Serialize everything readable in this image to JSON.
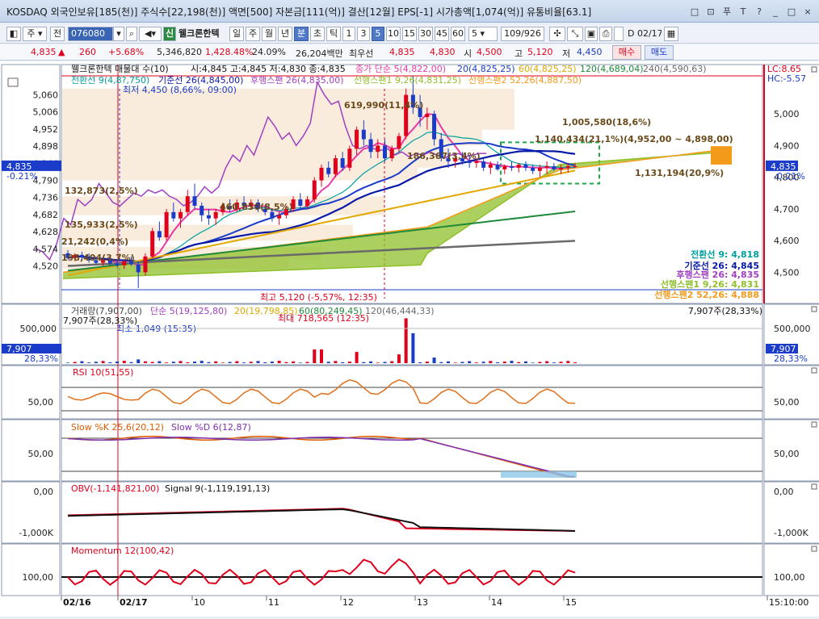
{
  "window": {
    "title": "KOSDAQ 외국인보유[185(천)] 주식수[22,198(천)] 액면[500] 자본금[111(억)] 결산[12월] EPS[-1] 시가총액[1,074(억)] 유통비율[63.1]",
    "controls": [
      "□",
      "⊡",
      "푸",
      "T",
      "?",
      "_",
      "□",
      "×"
    ]
  },
  "toolbar": {
    "type_label": "주",
    "prev_label": "전",
    "code_value": "076080",
    "stock_name": "웰크론한텍",
    "signal_label": "신",
    "periods": [
      "일",
      "주",
      "월",
      "년",
      "분",
      "초",
      "틱"
    ],
    "active_period": "분",
    "intervals": [
      "1",
      "3",
      "5",
      "10",
      "15",
      "30",
      "45",
      "60"
    ],
    "active_interval": "5",
    "count_value": "5",
    "page_value": "109/926",
    "date_value": "02/17"
  },
  "quote": {
    "price": "4,835",
    "arrow": "▲",
    "change": "260",
    "change_pct": "+5.68%",
    "volume": "5,346,820",
    "vol_ratio": "1,428.48%",
    "turnover": "24.09%",
    "amount": "26,204백만",
    "best_label": "최우선",
    "best_ask": "4,835",
    "best_bid": "4,830",
    "open_label": "시",
    "open": "4,500",
    "high_label": "고",
    "high": "5,120",
    "low_label": "저",
    "low": "4,450",
    "buy_label": "매수",
    "sell_label": "매도"
  },
  "colors": {
    "up": "#e0001b",
    "down": "#1a3cc8",
    "conversion": "#00a0a0",
    "base": "#0a1aa8",
    "lagging": "#a040c0",
    "leadingA": "#8fc02a",
    "leadingB": "#f49a1a",
    "ma5": "#e83aa8",
    "ma20": "#1a3cc8",
    "ma60": "#e0a800",
    "ma120": "#1e8a3a",
    "ma240": "#6a6a6a"
  },
  "chart_data": [
    {
      "type": "candlestick",
      "panel": "price",
      "title": "웰크론한텍 매물대 수(10)",
      "ohlc_label": "시:4,845 고:4,845 저:4,830 종:4,835",
      "ma_legend": [
        {
          "label": "종가 단순 5(4,822,00)",
          "color": "#e83aa8"
        },
        {
          "label": "20(4,825,25)",
          "color": "#1a3cc8"
        },
        {
          "label": "60(4,825,25)",
          "color": "#e0a800"
        },
        {
          "label": "120(4,689,04)",
          "color": "#1e8a3a"
        },
        {
          "label": "240(4,590,63)",
          "color": "#6a6a6a"
        }
      ],
      "ichimoku_legend": [
        {
          "label": "전환선 9(4,8?,750)",
          "color": "#00a0a0"
        },
        {
          "label": "기준선 26(4,845,00)",
          "color": "#0a1aa8"
        },
        {
          "label": "후행스팬 26(4,835,00)",
          "color": "#a040c0"
        },
        {
          "label": "선행스팬1 9,26(4,831,25)",
          "color": "#8fc02a"
        },
        {
          "label": "선행스팬2 52,26(4,887,50)",
          "color": "#f49a1a"
        }
      ],
      "ylim": [
        4450,
        5120
      ],
      "y_ticks": [
        "5,060",
        "5,006",
        "4,952",
        "4,898",
        "4,844",
        "4,790",
        "4,736",
        "4,682",
        "4,628",
        "4,574",
        "4,520"
      ],
      "right_ticks": [
        "5,000",
        "4,900",
        "4,800",
        "4,700",
        "4,600",
        "4,500"
      ],
      "current_label": "4,835",
      "current_pct": "-0.21%",
      "lc_label": "LC:8.65",
      "hc_label": "HC:-5.57",
      "x_ticks": [
        "02/16",
        "02/17",
        "10",
        "11",
        "12",
        "13",
        "14",
        "15",
        "15:10:00"
      ],
      "candles": [
        {
          "o": 4560,
          "h": 4570,
          "l": 4540,
          "c": 4545
        },
        {
          "o": 4545,
          "h": 4560,
          "l": 4535,
          "c": 4555
        },
        {
          "o": 4555,
          "h": 4565,
          "l": 4540,
          "c": 4548
        },
        {
          "o": 4548,
          "h": 4560,
          "l": 4530,
          "c": 4538
        },
        {
          "o": 4538,
          "h": 4550,
          "l": 4525,
          "c": 4530
        },
        {
          "o": 4530,
          "h": 4545,
          "l": 4520,
          "c": 4540
        },
        {
          "o": 4540,
          "h": 4555,
          "l": 4520,
          "c": 4528
        },
        {
          "o": 4528,
          "h": 4540,
          "l": 4515,
          "c": 4522
        },
        {
          "o": 4522,
          "h": 4540,
          "l": 4510,
          "c": 4535
        },
        {
          "o": 4535,
          "h": 4550,
          "l": 4520,
          "c": 4525
        },
        {
          "o": 4525,
          "h": 4535,
          "l": 4450,
          "c": 4500
        },
        {
          "o": 4500,
          "h": 4560,
          "l": 4490,
          "c": 4550
        },
        {
          "o": 4550,
          "h": 4640,
          "l": 4545,
          "c": 4630
        },
        {
          "o": 4630,
          "h": 4660,
          "l": 4600,
          "c": 4610
        },
        {
          "o": 4610,
          "h": 4700,
          "l": 4600,
          "c": 4690
        },
        {
          "o": 4690,
          "h": 4720,
          "l": 4660,
          "c": 4670
        },
        {
          "o": 4670,
          "h": 4700,
          "l": 4640,
          "c": 4690
        },
        {
          "o": 4690,
          "h": 4760,
          "l": 4680,
          "c": 4740
        },
        {
          "o": 4740,
          "h": 4780,
          "l": 4700,
          "c": 4710
        },
        {
          "o": 4710,
          "h": 4720,
          "l": 4660,
          "c": 4680
        },
        {
          "o": 4680,
          "h": 4700,
          "l": 4650,
          "c": 4670
        },
        {
          "o": 4670,
          "h": 4700,
          "l": 4650,
          "c": 4690
        },
        {
          "o": 4690,
          "h": 4720,
          "l": 4680,
          "c": 4710
        },
        {
          "o": 4710,
          "h": 4730,
          "l": 4690,
          "c": 4700
        },
        {
          "o": 4700,
          "h": 4730,
          "l": 4690,
          "c": 4720
        },
        {
          "o": 4720,
          "h": 4740,
          "l": 4700,
          "c": 4710
        },
        {
          "o": 4710,
          "h": 4730,
          "l": 4700,
          "c": 4720
        },
        {
          "o": 4720,
          "h": 4730,
          "l": 4690,
          "c": 4700
        },
        {
          "o": 4700,
          "h": 4710,
          "l": 4680,
          "c": 4690
        },
        {
          "o": 4690,
          "h": 4700,
          "l": 4660,
          "c": 4670
        },
        {
          "o": 4670,
          "h": 4690,
          "l": 4650,
          "c": 4680
        },
        {
          "o": 4680,
          "h": 4710,
          "l": 4670,
          "c": 4700
        },
        {
          "o": 4700,
          "h": 4740,
          "l": 4690,
          "c": 4730
        },
        {
          "o": 4730,
          "h": 4750,
          "l": 4700,
          "c": 4710
        },
        {
          "o": 4710,
          "h": 4740,
          "l": 4700,
          "c": 4730
        },
        {
          "o": 4730,
          "h": 4800,
          "l": 4720,
          "c": 4790
        },
        {
          "o": 4790,
          "h": 4840,
          "l": 4770,
          "c": 4830
        },
        {
          "o": 4830,
          "h": 4850,
          "l": 4800,
          "c": 4810
        },
        {
          "o": 4810,
          "h": 4870,
          "l": 4800,
          "c": 4860
        },
        {
          "o": 4860,
          "h": 4880,
          "l": 4820,
          "c": 4830
        },
        {
          "o": 4830,
          "h": 4900,
          "l": 4820,
          "c": 4890
        },
        {
          "o": 4890,
          "h": 4960,
          "l": 4870,
          "c": 4950
        },
        {
          "o": 4950,
          "h": 4980,
          "l": 4900,
          "c": 4920
        },
        {
          "o": 4920,
          "h": 4940,
          "l": 4860,
          "c": 4880
        },
        {
          "o": 4880,
          "h": 4920,
          "l": 4860,
          "c": 4900
        },
        {
          "o": 4900,
          "h": 4920,
          "l": 4850,
          "c": 4860
        },
        {
          "o": 4860,
          "h": 4900,
          "l": 4850,
          "c": 4890
        },
        {
          "o": 4890,
          "h": 4940,
          "l": 4880,
          "c": 4930
        },
        {
          "o": 4930,
          "h": 5080,
          "l": 4920,
          "c": 5060
        },
        {
          "o": 5060,
          "h": 5120,
          "l": 5000,
          "c": 5020
        },
        {
          "o": 5020,
          "h": 5060,
          "l": 4960,
          "c": 4990
        },
        {
          "o": 4990,
          "h": 5020,
          "l": 4950,
          "c": 5000
        },
        {
          "o": 5000,
          "h": 5010,
          "l": 4900,
          "c": 4920
        },
        {
          "o": 4920,
          "h": 4940,
          "l": 4850,
          "c": 4860
        },
        {
          "o": 4860,
          "h": 4890,
          "l": 4830,
          "c": 4850
        },
        {
          "o": 4850,
          "h": 4870,
          "l": 4830,
          "c": 4860
        },
        {
          "o": 4860,
          "h": 4880,
          "l": 4840,
          "c": 4850
        },
        {
          "o": 4850,
          "h": 4870,
          "l": 4830,
          "c": 4845
        },
        {
          "o": 4845,
          "h": 4860,
          "l": 4830,
          "c": 4850
        },
        {
          "o": 4850,
          "h": 4860,
          "l": 4820,
          "c": 4830
        },
        {
          "o": 4830,
          "h": 4850,
          "l": 4810,
          "c": 4840
        },
        {
          "o": 4840,
          "h": 4850,
          "l": 4820,
          "c": 4825
        },
        {
          "o": 4825,
          "h": 4840,
          "l": 4810,
          "c": 4835
        },
        {
          "o": 4835,
          "h": 4850,
          "l": 4820,
          "c": 4830
        },
        {
          "o": 4830,
          "h": 4845,
          "l": 4815,
          "c": 4840
        },
        {
          "o": 4840,
          "h": 4850,
          "l": 4820,
          "c": 4830
        },
        {
          "o": 4830,
          "h": 4840,
          "l": 4810,
          "c": 4820
        },
        {
          "o": 4820,
          "h": 4840,
          "l": 4800,
          "c": 4830
        },
        {
          "o": 4830,
          "h": 4850,
          "l": 4810,
          "c": 4835
        },
        {
          "o": 4835,
          "h": 4845,
          "l": 4820,
          "c": 4825
        },
        {
          "o": 4825,
          "h": 4840,
          "l": 4810,
          "c": 4830
        },
        {
          "o": 4830,
          "h": 4845,
          "l": 4815,
          "c": 4835
        },
        {
          "o": 4835,
          "h": 4845,
          "l": 4830,
          "c": 4835
        }
      ],
      "annotations": {
        "low_label": "최저 4,450 (8,66%, 09:00)",
        "high_label": "최고 5,120 (-5,57%, 12:35)",
        "volume_profile": [
          "1,005,580(18,6%)",
          "619,990(11,4%)",
          "1,140,434(21,1%)(4,952,00 ~ 4,898,00)",
          "186,367(3,4%)",
          "1,131,194(20,9%)",
          "132,873(2,5%)",
          "460,850(8,5%)",
          "135,933(2,5%)",
          "21,242(0,4%)",
          "198,404(3,7%)"
        ]
      },
      "right_legend": [
        {
          "label": "전환선 9: 4,818",
          "color": "#00a0a0"
        },
        {
          "label": "기준선 26: 4,845",
          "color": "#0a1aa8"
        },
        {
          "label": "후행스팬 26: 4,835",
          "color": "#a040c0"
        },
        {
          "label": "선행스팬1 9,26: 4,831",
          "color": "#8fc02a"
        },
        {
          "label": "선행스팬2 52,26: 4,888",
          "color": "#f49a1a"
        }
      ]
    },
    {
      "type": "bar",
      "panel": "volume",
      "legend": [
        {
          "label": "거래량(7,907,00)",
          "color": "#444"
        },
        {
          "label": "단순 5(19,125,80)",
          "color": "#a040c0"
        },
        {
          "label": "20(19,798,85)",
          "color": "#e0a800"
        },
        {
          "label": "60(80,249,45)",
          "color": "#1e8a3a"
        },
        {
          "label": "120(46,444,33)",
          "color": "#6a6a6a"
        }
      ],
      "left_note": "7,907주(28,33%)",
      "right_note": "7,907주(28,33%)",
      "max_label": "최대 718,565 (12:35)",
      "min_label": "최소 1,049 (15:35)",
      "y_tick": "500,000",
      "current_label": "7,907",
      "current_pct": "28,33%"
    },
    {
      "type": "line",
      "panel": "rsi",
      "legend": "RSI 10(51,55)",
      "y_tick": "50,00"
    },
    {
      "type": "line",
      "panel": "stochastic",
      "legend": [
        {
          "label": "Slow %K 25,6(20,12)",
          "color": "#e05a00"
        },
        {
          "label": "Slow %D 6(12,87)",
          "color": "#8030b0"
        }
      ],
      "y_tick": "50,00"
    },
    {
      "type": "line",
      "panel": "obv",
      "legend": [
        {
          "label": "OBV(-1,141,821,00)",
          "color": "#e0001b"
        },
        {
          "label": "Signal 9(-1,119,191,13)",
          "color": "#111"
        }
      ],
      "y_ticks": [
        "0,00",
        "-1,000K"
      ]
    },
    {
      "type": "line",
      "panel": "momentum",
      "legend": "Momentum 12(100,42)",
      "y_tick": "100,00"
    }
  ]
}
